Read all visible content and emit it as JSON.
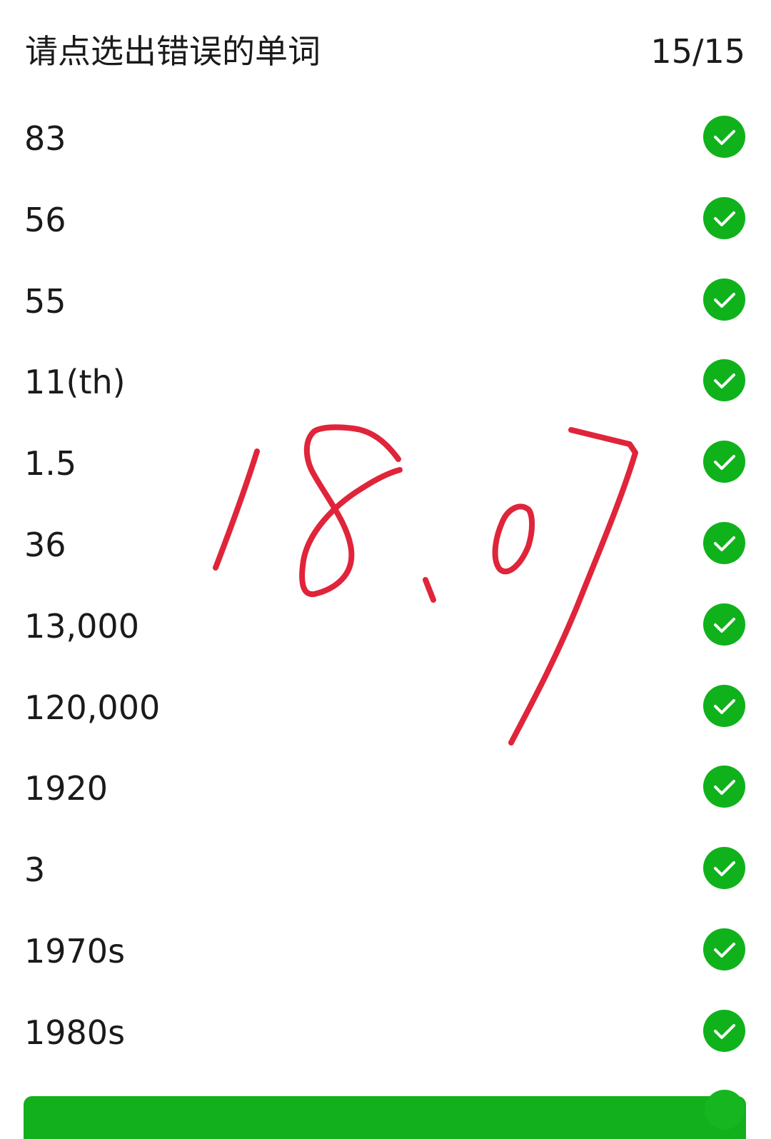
{
  "header": {
    "title": "请点选出错误的单词",
    "progress": "15/15"
  },
  "items": [
    {
      "label": "83",
      "status": "correct"
    },
    {
      "label": "56",
      "status": "correct"
    },
    {
      "label": "55",
      "status": "correct"
    },
    {
      "label": "11(th)",
      "status": "correct"
    },
    {
      "label": "1.5",
      "status": "correct"
    },
    {
      "label": "36",
      "status": "correct"
    },
    {
      "label": "13,000",
      "status": "correct"
    },
    {
      "label": "120,000",
      "status": "correct"
    },
    {
      "label": "1920",
      "status": "correct"
    },
    {
      "label": "3",
      "status": "correct"
    },
    {
      "label": "1970s",
      "status": "correct"
    },
    {
      "label": "1980s",
      "status": "correct"
    }
  ],
  "icons": {
    "row_status": "check-circle-icon"
  },
  "colors": {
    "accent_green": "#0fb21b",
    "handwriting_red": "#e0243a"
  },
  "handwriting_text": "18.07"
}
